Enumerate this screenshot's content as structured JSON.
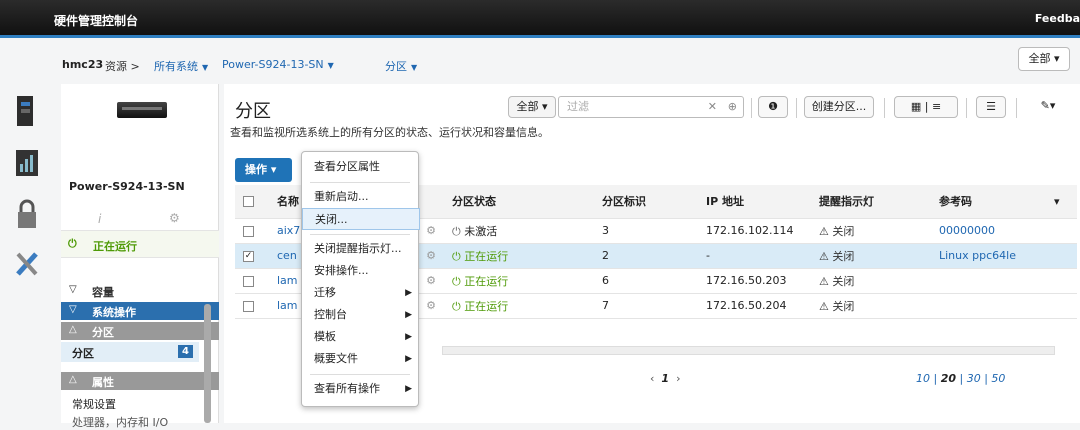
{
  "app": {
    "title": "硬件管理控制台",
    "feedback": "Feedba"
  },
  "breadcrumb": {
    "hmc": "hmc23",
    "resources": "资源 >",
    "all_systems": "所有系统",
    "system": "Power-S924-13-SN",
    "partitions": "分区"
  },
  "top_right": {
    "all_label": "全部"
  },
  "system_panel": {
    "system_name": "Power-S924-13-SN",
    "status": "正在运行",
    "sections": {
      "capacity": "容量",
      "system_ops": "系统操作",
      "partition": "分区",
      "partition_item": "分区",
      "partition_count": "4",
      "properties": "属性",
      "general": "常规设置",
      "processor": "处理器，内存和 I/O"
    }
  },
  "main": {
    "title": "分区",
    "description": "查看和监视所选系统上的所有分区的状态、运行状况和容量信息。",
    "filter_scope": "全部",
    "filter_placeholder": "过滤",
    "create_button": "创建分区...",
    "actions_button": "操作"
  },
  "table": {
    "columns": [
      "名称",
      "分区状态",
      "分区标识",
      "IP 地址",
      "提醒指示灯",
      "参考码"
    ],
    "rows": [
      {
        "name": "aix7",
        "state": "未激活",
        "id": "3",
        "ip": "172.16.102.114",
        "led": "关闭",
        "refcode": "00000000"
      },
      {
        "name": "cen",
        "state": "正在运行",
        "id": "2",
        "ip": "-",
        "led": "关闭",
        "refcode": "Linux ppc64le"
      },
      {
        "name": "lam",
        "state": "正在运行",
        "id": "6",
        "ip": "172.16.50.203",
        "led": "关闭",
        "refcode": ""
      },
      {
        "name": "lam",
        "state": "正在运行",
        "id": "7",
        "ip": "172.16.50.204",
        "led": "关闭",
        "refcode": ""
      }
    ]
  },
  "pagination": {
    "current": "1",
    "sizes": [
      "10",
      "20",
      "30",
      "50"
    ]
  },
  "context_menu": [
    "查看分区属性",
    "重新启动...",
    "关闭...",
    "关闭提醒指示灯...",
    "安排操作...",
    "迁移",
    "控制台",
    "模板",
    "概要文件",
    "查看所有操作"
  ],
  "colors": {
    "accent": "#2b6fae",
    "running": "#4e9a06",
    "selected": "#d9ebf7"
  }
}
